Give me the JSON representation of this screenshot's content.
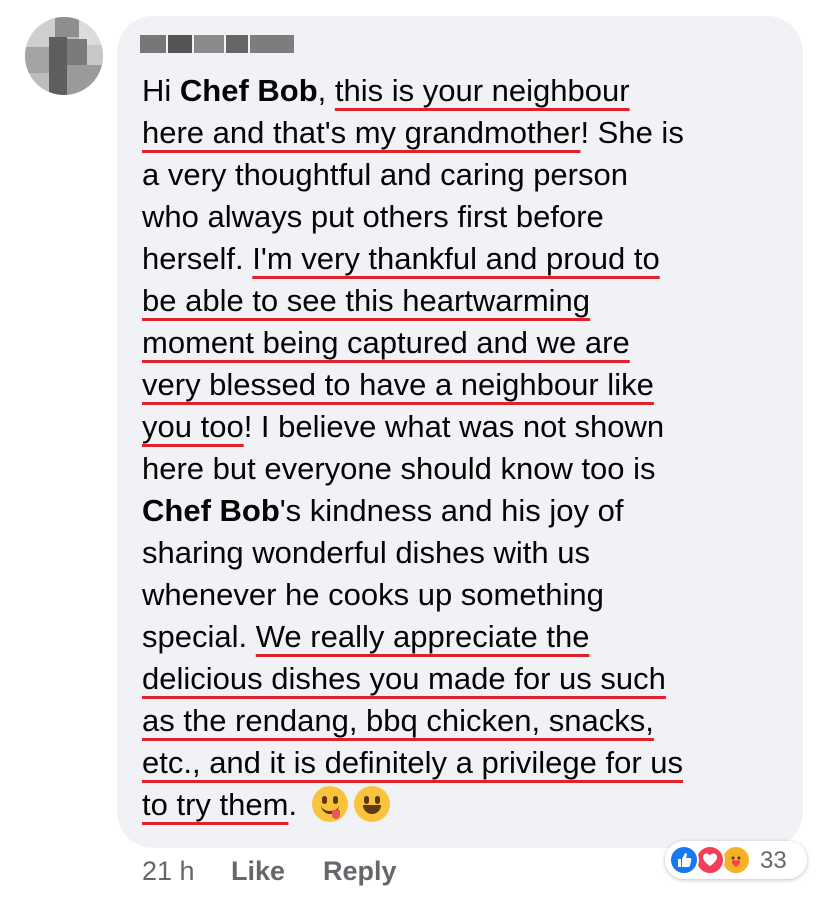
{
  "comment": {
    "lines": [
      [
        {
          "t": "Hi "
        },
        {
          "t": "Chef Bob",
          "b": true
        },
        {
          "t": ", "
        },
        {
          "t": "this is your neighbour",
          "u": true
        }
      ],
      [
        {
          "t": "here and that's my grandmother",
          "u": true
        },
        {
          "t": "! She is"
        }
      ],
      [
        {
          "t": "a very thoughtful and caring person"
        }
      ],
      [
        {
          "t": "who always put others first before"
        }
      ],
      [
        {
          "t": "herself. "
        },
        {
          "t": "I'm very thankful and proud to",
          "u": true
        }
      ],
      [
        {
          "t": "be able to see this heartwarming",
          "u": true
        }
      ],
      [
        {
          "t": "moment being captured and we are",
          "u": true
        }
      ],
      [
        {
          "t": "very blessed to have a neighbour like",
          "u": true
        }
      ],
      [
        {
          "t": "you too",
          "u": true
        },
        {
          "t": "! I believe what was not shown"
        }
      ],
      [
        {
          "t": "here but everyone should know too is"
        }
      ],
      [
        {
          "t": "Chef Bob",
          "b": true
        },
        {
          "t": "'s kindness and his joy of"
        }
      ],
      [
        {
          "t": "sharing wonderful dishes with us"
        }
      ],
      [
        {
          "t": "whenever he cooks up something"
        }
      ],
      [
        {
          "t": "special. "
        },
        {
          "t": "We really appreciate the",
          "u": true
        }
      ],
      [
        {
          "t": "delicious dishes you made for us such",
          "u": true
        }
      ],
      [
        {
          "t": "as the rendang, bbq chicken, snacks,",
          "u": true
        }
      ],
      [
        {
          "t": "etc., and it is definitely a privilege for us",
          "u": true
        }
      ],
      [
        {
          "t": "to try them",
          "u": true
        },
        {
          "t": ". "
        }
      ]
    ],
    "emojis": [
      "face-savoring-food-emoji",
      "grinning-face-emoji"
    ]
  },
  "footer": {
    "time": "21 h",
    "like_label": "Like",
    "reply_label": "Reply"
  },
  "reactions": {
    "icons": [
      "like-reaction-icon",
      "love-reaction-icon",
      "care-reaction-icon"
    ],
    "count": "33"
  },
  "colors": {
    "bubble": "#f0f2f5",
    "underline": "#e0202a",
    "like": "#1877f2",
    "love": "#f33e58",
    "care": "#f7b125",
    "meta": "#65676b"
  }
}
